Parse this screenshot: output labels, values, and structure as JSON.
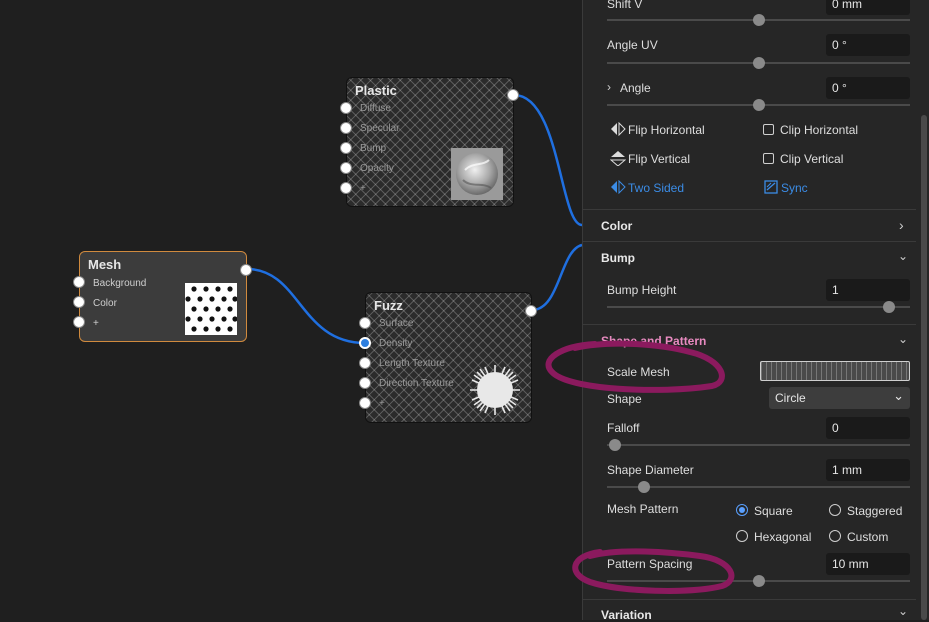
{
  "graph": {
    "nodes": {
      "plastic": {
        "title": "Plastic",
        "ports": [
          "Diffuse",
          "Specular",
          "Bump",
          "Opacity",
          "+"
        ]
      },
      "mesh": {
        "title": "Mesh",
        "ports": [
          "Background",
          "Color",
          "+"
        ]
      },
      "fuzz": {
        "title": "Fuzz",
        "ports": [
          "Surface",
          "Density",
          "Length Texture",
          "Direction Texture",
          "+"
        ]
      }
    }
  },
  "panel": {
    "shift_v": {
      "label": "Shift V",
      "value": "0 mm"
    },
    "angle_uv": {
      "label": "Angle UV",
      "value": "0 °"
    },
    "angle": {
      "label": "Angle",
      "value": "0 °"
    },
    "flip_horizontal": "Flip Horizontal",
    "clip_horizontal": "Clip Horizontal",
    "flip_vertical": "Flip Vertical",
    "clip_vertical": "Clip Vertical",
    "two_sided": "Two Sided",
    "sync": "Sync",
    "color_section": "Color",
    "bump_section": "Bump",
    "bump_height": {
      "label": "Bump Height",
      "value": "1"
    },
    "shape_section": "Shape and Pattern",
    "scale_mesh": "Scale Mesh",
    "shape": {
      "label": "Shape",
      "value": "Circle"
    },
    "falloff": {
      "label": "Falloff",
      "value": "0"
    },
    "shape_diameter": {
      "label": "Shape Diameter",
      "value": "1 mm"
    },
    "mesh_pattern": {
      "label": "Mesh Pattern",
      "options": [
        "Square",
        "Staggered",
        "Hexagonal",
        "Custom"
      ],
      "selected": "Square"
    },
    "pattern_spacing": {
      "label": "Pattern Spacing",
      "value": "10 mm"
    },
    "variation_section": "Variation"
  },
  "colors": {
    "wire": "#1f6fe0",
    "mesh_border": "#d08a3e",
    "annotation": "#8b1a5e",
    "accent_blue": "#3b8ce6",
    "section_pink": "#e88ac0"
  }
}
